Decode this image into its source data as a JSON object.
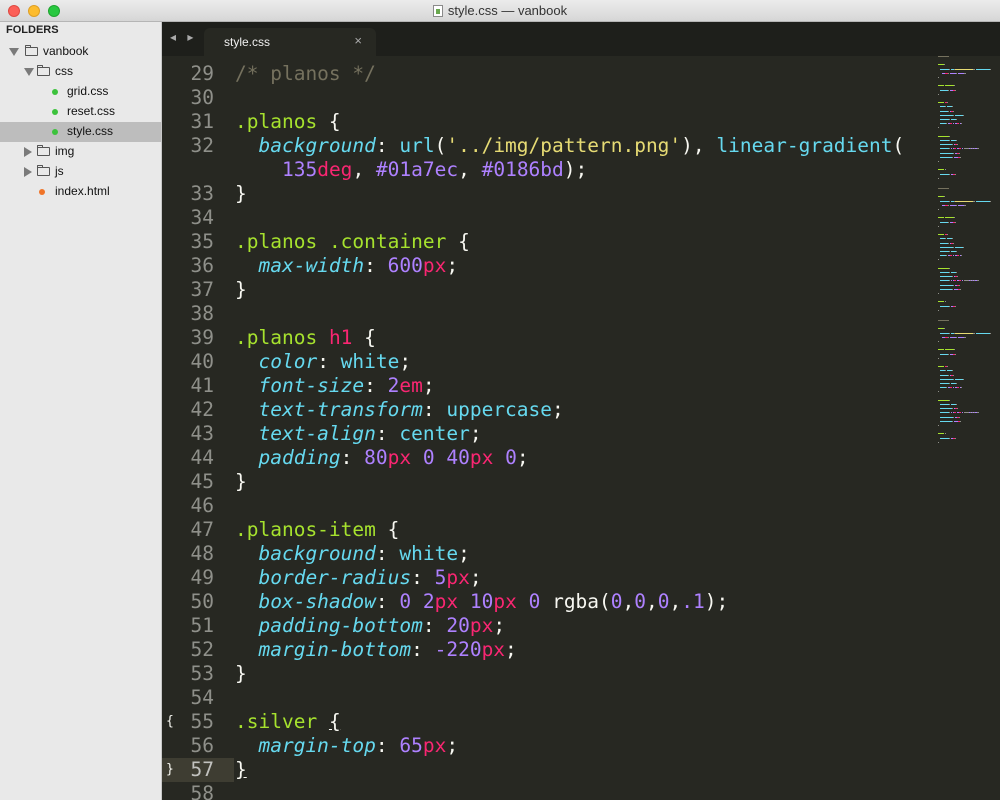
{
  "window": {
    "title": "style.css — vanbook"
  },
  "sidebar": {
    "header": "FOLDERS",
    "items": [
      {
        "label": "vanbook",
        "type": "folder",
        "expanded": true,
        "level": 0
      },
      {
        "label": "css",
        "type": "folder",
        "expanded": true,
        "level": 1
      },
      {
        "label": "grid.css",
        "type": "file",
        "dot": "green",
        "level": 2
      },
      {
        "label": "reset.css",
        "type": "file",
        "dot": "green",
        "level": 2
      },
      {
        "label": "style.css",
        "type": "file",
        "dot": "green",
        "level": 2,
        "selected": true
      },
      {
        "label": "img",
        "type": "folder",
        "expanded": false,
        "level": 1
      },
      {
        "label": "js",
        "type": "folder",
        "expanded": false,
        "level": 1
      },
      {
        "label": "index.html",
        "type": "file",
        "dot": "orange",
        "level": 1
      }
    ]
  },
  "tabbar": {
    "nav_arrows": "◂ ▸",
    "active_tab": {
      "label": "style.css",
      "close": "×"
    }
  },
  "editor": {
    "active_line": 57,
    "fold_marks": [
      {
        "line": 55,
        "mark": "{"
      },
      {
        "line": 57,
        "mark": "}"
      }
    ],
    "line_numbers": [
      "29",
      "30",
      "31",
      "32",
      "",
      "33",
      "34",
      "35",
      "36",
      "37",
      "38",
      "39",
      "40",
      "41",
      "42",
      "43",
      "44",
      "45",
      "46",
      "47",
      "48",
      "49",
      "50",
      "51",
      "52",
      "53",
      "54",
      "55",
      "56",
      "57",
      "58"
    ],
    "code_lines": [
      [
        {
          "t": "/* planos */",
          "c": "comment"
        }
      ],
      [],
      [
        {
          "t": ".planos",
          "c": "sel"
        },
        {
          "t": " {",
          "c": "punc"
        }
      ],
      [
        {
          "t": "  ",
          "c": "punc"
        },
        {
          "t": "background",
          "c": "prop"
        },
        {
          "t": ": ",
          "c": "punc"
        },
        {
          "t": "url",
          "c": "fn"
        },
        {
          "t": "(",
          "c": "punc"
        },
        {
          "t": "'../img/pattern.png'",
          "c": "str"
        },
        {
          "t": "), ",
          "c": "punc"
        },
        {
          "t": "linear-gradient",
          "c": "fn"
        },
        {
          "t": "(",
          "c": "punc"
        }
      ],
      [
        {
          "t": "    ",
          "c": "punc"
        },
        {
          "t": "135",
          "c": "num"
        },
        {
          "t": "deg",
          "c": "unit"
        },
        {
          "t": ", ",
          "c": "punc"
        },
        {
          "t": "#01a7ec",
          "c": "num"
        },
        {
          "t": ", ",
          "c": "punc"
        },
        {
          "t": "#0186bd",
          "c": "num"
        },
        {
          "t": ");",
          "c": "punc"
        }
      ],
      [
        {
          "t": "}",
          "c": "punc"
        }
      ],
      [],
      [
        {
          "t": ".planos",
          "c": "sel"
        },
        {
          "t": " ",
          "c": "punc"
        },
        {
          "t": ".container",
          "c": "sel"
        },
        {
          "t": " {",
          "c": "punc"
        }
      ],
      [
        {
          "t": "  ",
          "c": "punc"
        },
        {
          "t": "max-width",
          "c": "prop"
        },
        {
          "t": ": ",
          "c": "punc"
        },
        {
          "t": "600",
          "c": "num"
        },
        {
          "t": "px",
          "c": "unit"
        },
        {
          "t": ";",
          "c": "punc"
        }
      ],
      [
        {
          "t": "}",
          "c": "punc"
        }
      ],
      [],
      [
        {
          "t": ".planos",
          "c": "sel"
        },
        {
          "t": " ",
          "c": "punc"
        },
        {
          "t": "h1",
          "c": "tag"
        },
        {
          "t": " {",
          "c": "punc"
        }
      ],
      [
        {
          "t": "  ",
          "c": "punc"
        },
        {
          "t": "color",
          "c": "prop"
        },
        {
          "t": ": ",
          "c": "punc"
        },
        {
          "t": "white",
          "c": "kw"
        },
        {
          "t": ";",
          "c": "punc"
        }
      ],
      [
        {
          "t": "  ",
          "c": "punc"
        },
        {
          "t": "font-size",
          "c": "prop"
        },
        {
          "t": ": ",
          "c": "punc"
        },
        {
          "t": "2",
          "c": "num"
        },
        {
          "t": "em",
          "c": "unit"
        },
        {
          "t": ";",
          "c": "punc"
        }
      ],
      [
        {
          "t": "  ",
          "c": "punc"
        },
        {
          "t": "text-transform",
          "c": "prop"
        },
        {
          "t": ": ",
          "c": "punc"
        },
        {
          "t": "uppercase",
          "c": "kw"
        },
        {
          "t": ";",
          "c": "punc"
        }
      ],
      [
        {
          "t": "  ",
          "c": "punc"
        },
        {
          "t": "text-align",
          "c": "prop"
        },
        {
          "t": ": ",
          "c": "punc"
        },
        {
          "t": "center",
          "c": "kw"
        },
        {
          "t": ";",
          "c": "punc"
        }
      ],
      [
        {
          "t": "  ",
          "c": "punc"
        },
        {
          "t": "padding",
          "c": "prop"
        },
        {
          "t": ": ",
          "c": "punc"
        },
        {
          "t": "80",
          "c": "num"
        },
        {
          "t": "px",
          "c": "unit"
        },
        {
          "t": " ",
          "c": "punc"
        },
        {
          "t": "0",
          "c": "num"
        },
        {
          "t": " ",
          "c": "punc"
        },
        {
          "t": "40",
          "c": "num"
        },
        {
          "t": "px",
          "c": "unit"
        },
        {
          "t": " ",
          "c": "punc"
        },
        {
          "t": "0",
          "c": "num"
        },
        {
          "t": ";",
          "c": "punc"
        }
      ],
      [
        {
          "t": "}",
          "c": "punc"
        }
      ],
      [],
      [
        {
          "t": ".planos-item",
          "c": "sel"
        },
        {
          "t": " {",
          "c": "punc"
        }
      ],
      [
        {
          "t": "  ",
          "c": "punc"
        },
        {
          "t": "background",
          "c": "prop"
        },
        {
          "t": ": ",
          "c": "punc"
        },
        {
          "t": "white",
          "c": "kw"
        },
        {
          "t": ";",
          "c": "punc"
        }
      ],
      [
        {
          "t": "  ",
          "c": "punc"
        },
        {
          "t": "border-radius",
          "c": "prop"
        },
        {
          "t": ": ",
          "c": "punc"
        },
        {
          "t": "5",
          "c": "num"
        },
        {
          "t": "px",
          "c": "unit"
        },
        {
          "t": ";",
          "c": "punc"
        }
      ],
      [
        {
          "t": "  ",
          "c": "punc"
        },
        {
          "t": "box-shadow",
          "c": "prop"
        },
        {
          "t": ": ",
          "c": "punc"
        },
        {
          "t": "0",
          "c": "num"
        },
        {
          "t": " ",
          "c": "punc"
        },
        {
          "t": "2",
          "c": "num"
        },
        {
          "t": "px",
          "c": "unit"
        },
        {
          "t": " ",
          "c": "punc"
        },
        {
          "t": "10",
          "c": "num"
        },
        {
          "t": "px",
          "c": "unit"
        },
        {
          "t": " ",
          "c": "punc"
        },
        {
          "t": "0",
          "c": "num"
        },
        {
          "t": " ",
          "c": "punc"
        },
        {
          "t": "rgba",
          "c": "punc"
        },
        {
          "t": "(",
          "c": "punc"
        },
        {
          "t": "0",
          "c": "num"
        },
        {
          "t": ",",
          "c": "punc"
        },
        {
          "t": "0",
          "c": "num"
        },
        {
          "t": ",",
          "c": "punc"
        },
        {
          "t": "0",
          "c": "num"
        },
        {
          "t": ",",
          "c": "punc"
        },
        {
          "t": ".1",
          "c": "num"
        },
        {
          "t": ");",
          "c": "punc"
        }
      ],
      [
        {
          "t": "  ",
          "c": "punc"
        },
        {
          "t": "padding-bottom",
          "c": "prop"
        },
        {
          "t": ": ",
          "c": "punc"
        },
        {
          "t": "20",
          "c": "num"
        },
        {
          "t": "px",
          "c": "unit"
        },
        {
          "t": ";",
          "c": "punc"
        }
      ],
      [
        {
          "t": "  ",
          "c": "punc"
        },
        {
          "t": "margin-bottom",
          "c": "prop"
        },
        {
          "t": ": ",
          "c": "punc"
        },
        {
          "t": "-220",
          "c": "num"
        },
        {
          "t": "px",
          "c": "unit"
        },
        {
          "t": ";",
          "c": "punc"
        }
      ],
      [
        {
          "t": "}",
          "c": "punc"
        }
      ],
      [],
      [
        {
          "t": ".silver",
          "c": "sel"
        },
        {
          "t": " ",
          "c": "punc"
        },
        {
          "t": "{",
          "c": "match"
        }
      ],
      [
        {
          "t": "  ",
          "c": "punc"
        },
        {
          "t": "margin-top",
          "c": "prop"
        },
        {
          "t": ": ",
          "c": "punc"
        },
        {
          "t": "65",
          "c": "num"
        },
        {
          "t": "px",
          "c": "unit"
        },
        {
          "t": ";",
          "c": "punc"
        }
      ],
      [
        {
          "t": "}",
          "c": "match"
        }
      ],
      []
    ]
  },
  "colors": {
    "background": "#272822",
    "comment": "#75715e",
    "selector": "#a6e22e",
    "tag": "#f92672",
    "property": "#66d9ef",
    "string": "#e6db74",
    "number": "#ae81ff",
    "unit": "#f92672",
    "keyword": "#66d9ef",
    "text": "#f8f8f2"
  }
}
